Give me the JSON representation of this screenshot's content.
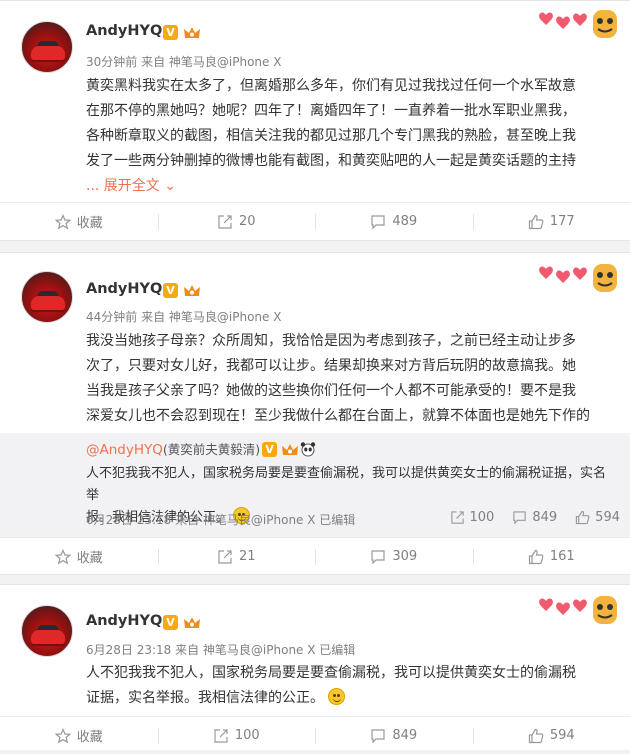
{
  "colors": {
    "accent": "#eb7350",
    "badge": "#f7a90f",
    "muted": "#808080"
  },
  "posts": [
    {
      "username": "AndyHYQ",
      "meta": "30分钟前 来自 神笔马良@iPhone X",
      "lines": [
        "黄奕黑料我实在太多了，但离婚那么多年，你们有见过我找过任何一个水军故意",
        "在那不停的黑她吗？她呢？四年了！离婚四年了！一直养着一批水军职业黑我，",
        "各种断章取义的截图，相信关注我的都见过那几个专门黑我的熟脸，甚至晚上我",
        "发了一些两分钟删掉的微博也能有截图，和黄奕贴吧的人一起是黄奕话题的主持"
      ],
      "expand": "... 展开全文 ⌄",
      "actions": {
        "fav": "收藏",
        "repost": "20",
        "comment": "489",
        "like": "177"
      }
    },
    {
      "username": "AndyHYQ",
      "meta": "44分钟前 来自 神笔马良@iPhone X",
      "lines": [
        "我没当她孩子母亲？众所周知，我恰恰是因为考虑到孩子，之前已经主动让步多",
        "次了，只要对女儿好，我都可以让步。结果却换来对方背后玩阴的故意搞我。她",
        "当我是孩子父亲了吗？她做的这些换你们任何一个人都不可能承受的！要不是我",
        "深爱女儿也不会忍到现在！至少我做什么都在台面上，就算不体面也是她先下作的"
      ],
      "repost": {
        "author": "@AndyHYQ",
        "author_note": "(黄奕前夫黄毅清)",
        "lines": [
          "人不犯我我不犯人，国家税务局要是要查偷漏税，我可以提供黄奕女士的偷漏税证据，实名举",
          "报。我相信法律的公正。"
        ],
        "meta": "6月28日 23:18 来自 神笔马良@iPhone X 已编辑",
        "stats": {
          "repost": "100",
          "comment": "849",
          "like": "594"
        }
      },
      "actions": {
        "fav": "收藏",
        "repost": "21",
        "comment": "309",
        "like": "161"
      }
    },
    {
      "username": "AndyHYQ",
      "meta": "6月28日 23:18 来自 神笔马良@iPhone X 已编辑",
      "lines": [
        "人不犯我我不犯人，国家税务局要是要查偷漏税，我可以提供黄奕女士的偷漏税",
        "证据，实名举报。我相信法律的公正。"
      ],
      "actions": {
        "fav": "收藏",
        "repost": "100",
        "comment": "849",
        "like": "594"
      }
    }
  ]
}
